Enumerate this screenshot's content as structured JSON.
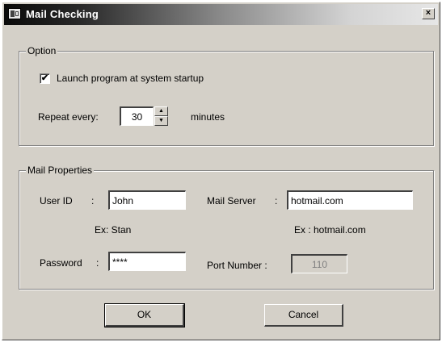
{
  "window": {
    "title": "Mail Checking",
    "close_glyph": "×"
  },
  "option": {
    "legend": "Option",
    "launch_label": "Launch program at system startup",
    "launch_checked": true,
    "check_glyph": "✔",
    "repeat_label": "Repeat every:",
    "repeat_value": "30",
    "minutes_label": "minutes",
    "spin_up_glyph": "▲",
    "spin_down_glyph": "▼"
  },
  "mail": {
    "legend": "Mail Properties",
    "userid_label": "User ID",
    "colon": ":",
    "userid_value": "John",
    "userid_example": "Ex: Stan",
    "server_label": "Mail Server",
    "server_value": "hotmail.com",
    "server_example": "Ex : hotmail.com",
    "password_label": "Password",
    "password_value": "****",
    "port_label": "Port Number :",
    "port_value": "110"
  },
  "buttons": {
    "ok": "OK",
    "cancel": "Cancel"
  }
}
